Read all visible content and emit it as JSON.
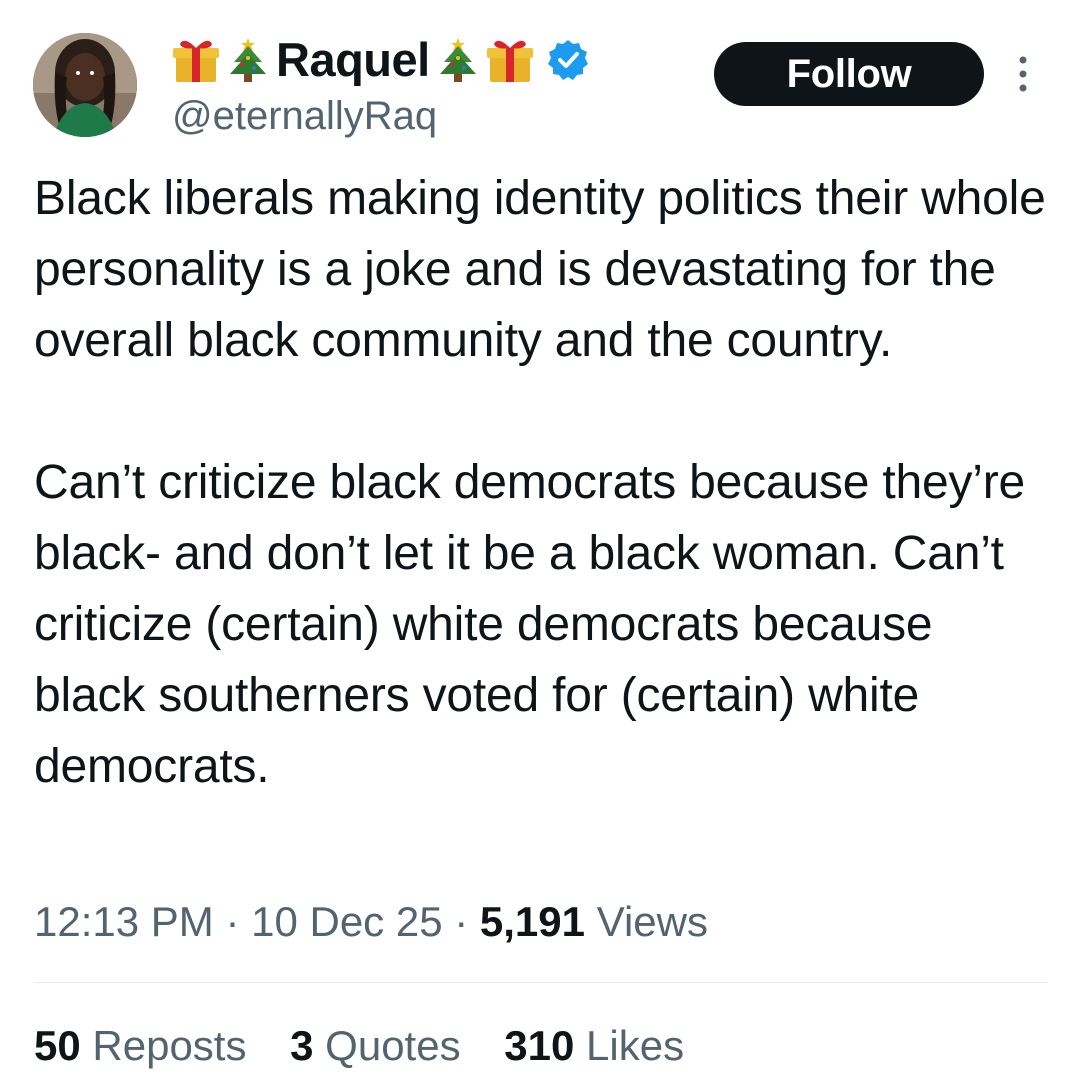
{
  "author": {
    "display_name": "Raquel",
    "name_emojis_left": [
      "gift-emoji",
      "christmas-tree-emoji"
    ],
    "name_emojis_right": [
      "christmas-tree-emoji",
      "gift-emoji"
    ],
    "handle": "@eternallyRaq",
    "verified": true
  },
  "follow_button": {
    "label": "Follow"
  },
  "more_menu": {
    "icon": "more-vertical-icon"
  },
  "tweet": {
    "paragraphs": [
      "Black liberals making identity politics their whole personality is a joke and is devastating for the overall black community and the country.",
      "Can’t criticize black democrats because they’re black- and don’t let it be a black woman. Can’t criticize (certain) white democrats because black southerners voted for (certain) white democrats."
    ]
  },
  "meta": {
    "time": "12:13 PM",
    "separator": " · ",
    "date": "10 Dec 25",
    "views_count": "5,191",
    "views_label": "Views"
  },
  "stats": {
    "reposts_count": "50",
    "reposts_label": "Reposts",
    "quotes_count": "3",
    "quotes_label": "Quotes",
    "likes_count": "310",
    "likes_label": "Likes"
  },
  "colors": {
    "text_primary": "#0f1419",
    "text_secondary": "#536471",
    "verified_blue": "#1d9bf0",
    "follow_bg": "#0f1419"
  }
}
